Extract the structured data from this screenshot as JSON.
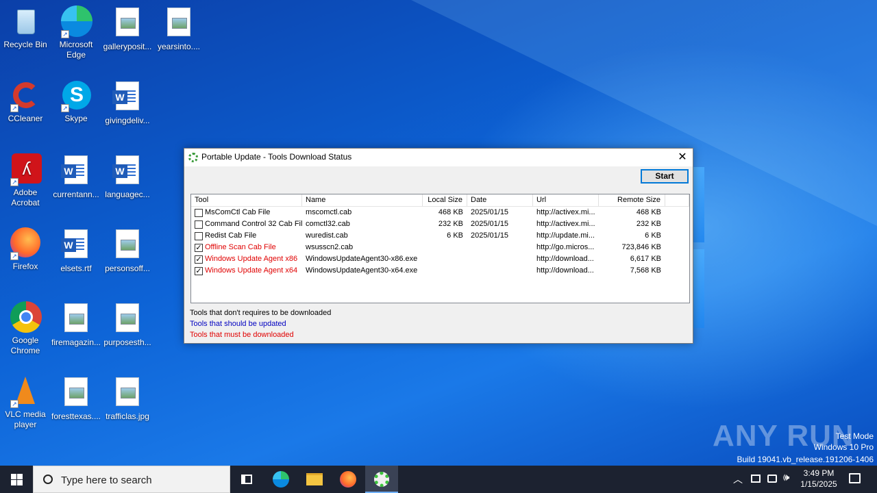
{
  "desktop": {
    "icons": [
      {
        "label": "Recycle Bin"
      },
      {
        "label": "Microsoft Edge"
      },
      {
        "label": "galleryposit..."
      },
      {
        "label": "yearsinto...."
      },
      {
        "label": "CCleaner"
      },
      {
        "label": "Skype"
      },
      {
        "label": "givingdeliv..."
      },
      {
        "label": "Adobe Acrobat"
      },
      {
        "label": "currentann..."
      },
      {
        "label": "languagec..."
      },
      {
        "label": "Firefox"
      },
      {
        "label": "elsets.rtf"
      },
      {
        "label": "personsoff..."
      },
      {
        "label": "Google Chrome"
      },
      {
        "label": "firemagazin..."
      },
      {
        "label": "purposesth..."
      },
      {
        "label": "VLC media player"
      },
      {
        "label": "foresttexas...."
      },
      {
        "label": "trafficlas.jpg"
      }
    ]
  },
  "dialog": {
    "title": "Portable Update - Tools Download Status",
    "start_label": "Start",
    "columns": [
      "Tool",
      "Name",
      "Local Size",
      "Date",
      "Url",
      "Remote Size"
    ],
    "rows": [
      {
        "checked": false,
        "tool": "MsComCtl Cab File",
        "name": "mscomctl.cab",
        "local_size": "468 KB",
        "date": "2025/01/15",
        "url": "http://activex.mi...",
        "remote_size": "468 KB"
      },
      {
        "checked": false,
        "tool": "Command Control 32 Cab File",
        "name": "comctl32.cab",
        "local_size": "232 KB",
        "date": "2025/01/15",
        "url": "http://activex.mi...",
        "remote_size": "232 KB"
      },
      {
        "checked": false,
        "tool": "Redist Cab File",
        "name": "wuredist.cab",
        "local_size": "6 KB",
        "date": "2025/01/15",
        "url": "http://update.mi...",
        "remote_size": "6 KB"
      },
      {
        "checked": true,
        "tool": "Offline Scan Cab File",
        "name": "wsusscn2.cab",
        "local_size": "",
        "date": "",
        "url": "http://go.micros...",
        "remote_size": "723,846 KB"
      },
      {
        "checked": true,
        "tool": "Windows Update Agent x86",
        "name": "WindowsUpdateAgent30-x86.exe",
        "local_size": "",
        "date": "",
        "url": "http://download...",
        "remote_size": "6,617 KB"
      },
      {
        "checked": true,
        "tool": "Windows Update Agent x64",
        "name": "WindowsUpdateAgent30-x64.exe",
        "local_size": "",
        "date": "",
        "url": "http://download...",
        "remote_size": "7,568 KB"
      }
    ],
    "legend": {
      "no_download": "Tools that don't requires to be downloaded",
      "should_update": "Tools that should be updated",
      "must_download": "Tools that must be downloaded"
    },
    "colors": {
      "normal": "#000000",
      "should_update": "#0000c0",
      "must_download": "#e00000"
    }
  },
  "watermark": {
    "brand": "ANY RUN",
    "test_mode": "Test Mode",
    "edition": "Windows 10 Pro",
    "build": "Build 19041.vb_release.191206-1406"
  },
  "taskbar": {
    "search_placeholder": "Type here to search",
    "time": "3:49 PM",
    "date": "1/15/2025"
  }
}
